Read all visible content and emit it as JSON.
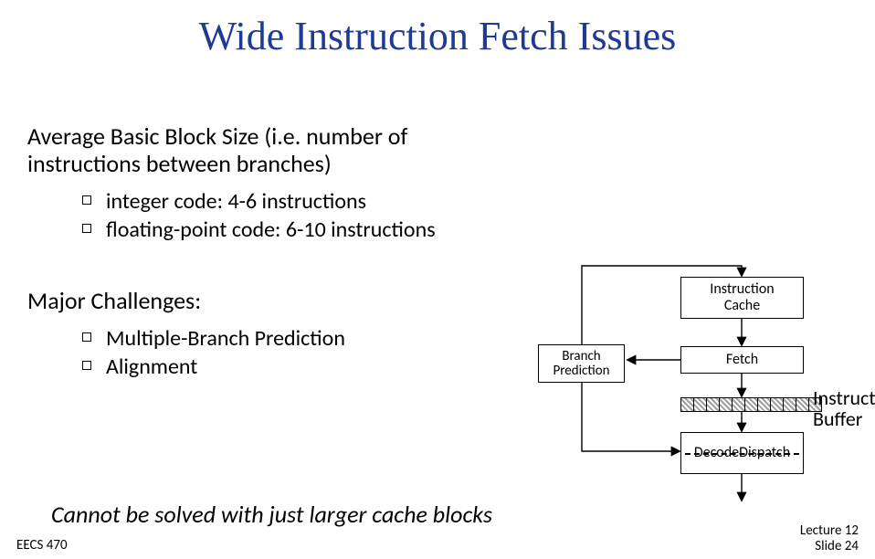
{
  "title": "Wide Instruction Fetch Issues",
  "avg_block": {
    "heading": "Average Basic Block Size (i.e. number of instructions between branches)",
    "items": [
      "integer code: 4-6 instructions",
      "floating-point code: 6-10 instructions"
    ]
  },
  "challenges": {
    "heading": "Major Challenges:",
    "items": [
      "Multiple-Branch Prediction",
      "Alignment"
    ]
  },
  "diagram": {
    "instruction_cache": "Instruction\nCache",
    "fetch": "Fetch",
    "branch_prediction": "Branch\nPrediction",
    "decode": "Decode",
    "dispatch": "Dispatch",
    "instruction_buffer": "Instruction\nBuffer"
  },
  "conclusion": "Cannot be solved with just larger cache blocks",
  "footer": {
    "course": "EECS 470",
    "lecture": "Lecture 12",
    "slide": "Slide 24"
  }
}
